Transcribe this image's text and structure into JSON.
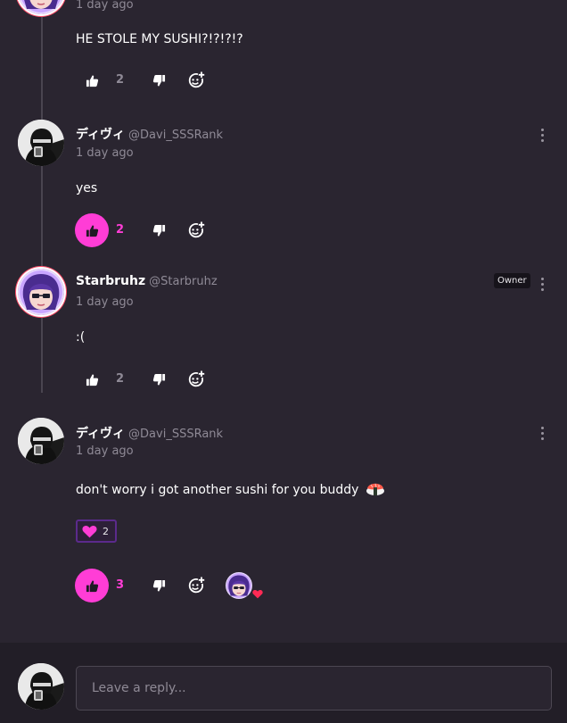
{
  "comments": [
    {
      "time": "1 day ago",
      "body": "HE STOLE MY SUSHI?!?!?!?",
      "likes": "2",
      "liked": false
    },
    {
      "name": "ディヴィ",
      "handle": "@Davi_SSSRank",
      "time": "1 day ago",
      "body": "yes",
      "likes": "2",
      "liked": true
    },
    {
      "name": "Starbruhz",
      "handle": "@Starbruhz",
      "badge": "Owner",
      "time": "1 day ago",
      "body": ":(",
      "likes": "2",
      "liked": false
    },
    {
      "name": "ディヴィ",
      "handle": "@Davi_SSSRank",
      "time": "1 day ago",
      "body": "don't worry i got another sushi for you buddy",
      "emoji": "sushi-icon",
      "reaction": {
        "icon": "heart-icon",
        "count": "2"
      },
      "likes": "3",
      "liked": true,
      "creator_heart": true
    }
  ],
  "reply": {
    "placeholder": "Leave a reply..."
  },
  "colors": {
    "background": "#2a2530",
    "accent": "#ff3dd6",
    "muted": "#8f8a96",
    "reply_bar": "#221e27",
    "owner_ring": "#ff4e6a"
  },
  "icons": {
    "like": "thumbs-up-icon",
    "dislike": "thumbs-down-icon",
    "react": "add-reaction-icon",
    "more": "more-vertical-icon"
  }
}
